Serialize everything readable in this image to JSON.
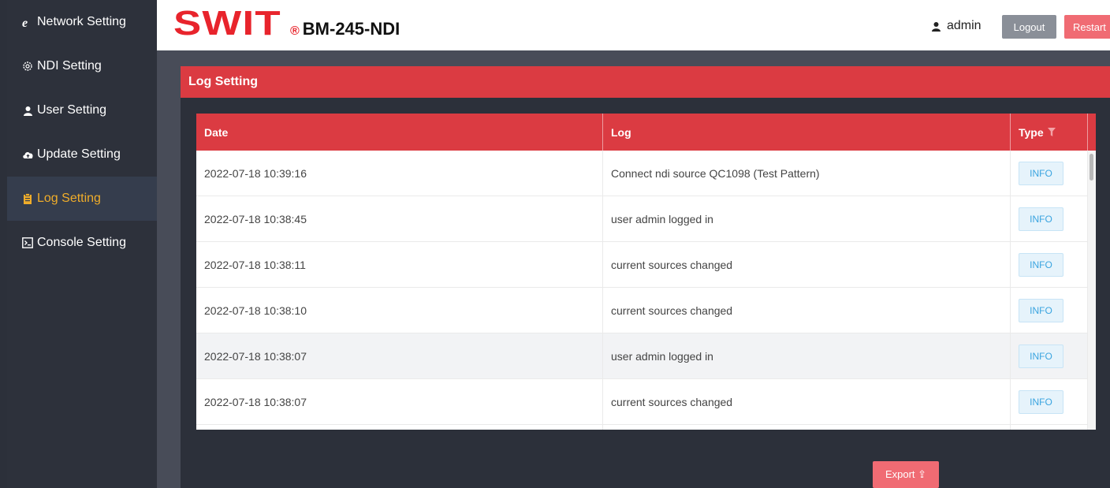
{
  "sidebar": {
    "items": [
      {
        "label": "Network Setting",
        "icon": "ie-icon"
      },
      {
        "label": "NDI Setting",
        "icon": "gear-icon"
      },
      {
        "label": "User Setting",
        "icon": "user-icon"
      },
      {
        "label": "Update Setting",
        "icon": "cloud-upload-icon"
      },
      {
        "label": "Log Setting",
        "icon": "clipboard-icon",
        "active": true
      },
      {
        "label": "Console Setting",
        "icon": "terminal-icon"
      }
    ]
  },
  "header": {
    "brand": "SWIT",
    "reg_mark": "®",
    "model": "BM-245-NDI",
    "user": "admin",
    "logout_label": "Logout",
    "restart_label": "Restart"
  },
  "panel": {
    "title": "Log Setting",
    "columns": [
      "Date",
      "Log",
      "Type"
    ],
    "rows": [
      {
        "date": "2022-07-18 10:39:16",
        "log": "Connect ndi source QC1098 (Test Pattern)",
        "type": "INFO"
      },
      {
        "date": "2022-07-18 10:38:45",
        "log": "user admin logged in",
        "type": "INFO"
      },
      {
        "date": "2022-07-18 10:38:11",
        "log": "current sources changed",
        "type": "INFO"
      },
      {
        "date": "2022-07-18 10:38:10",
        "log": "current sources changed",
        "type": "INFO"
      },
      {
        "date": "2022-07-18 10:38:07",
        "log": "user admin logged in",
        "type": "INFO"
      },
      {
        "date": "2022-07-18 10:38:07",
        "log": "current sources changed",
        "type": "INFO"
      }
    ],
    "export_label": "Export ⇪"
  },
  "colors": {
    "accent": "#db3b42",
    "active": "#f0ad2a",
    "tag": "#3aa4e0"
  }
}
